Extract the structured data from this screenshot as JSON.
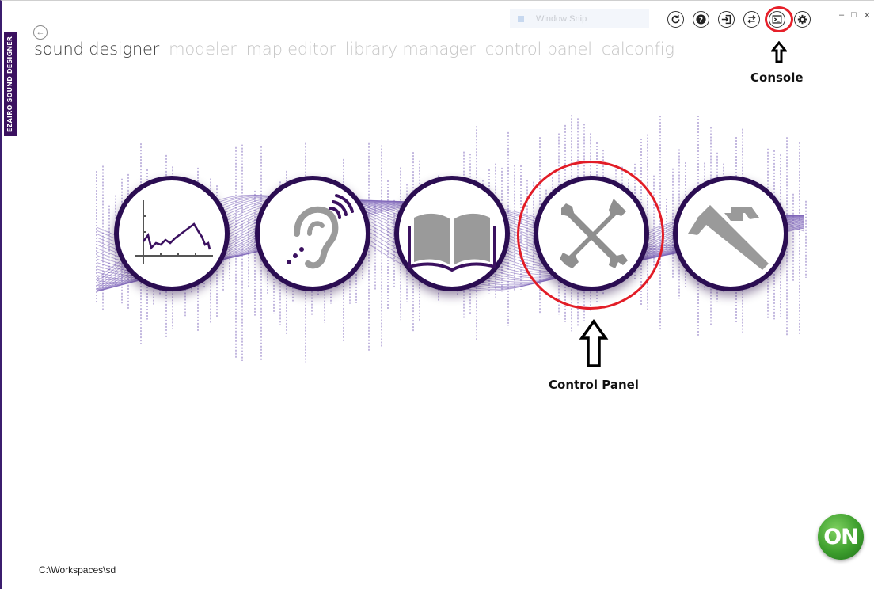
{
  "app": {
    "brand_vertical": "EZAIRO SOUND DESIGNER",
    "workspace_path": "C:\\Workspaces\\sd"
  },
  "nav": {
    "items": [
      "sound designer",
      "modeler",
      "map editor",
      "library manager",
      "control panel",
      "calconfig"
    ],
    "active": "sound designer"
  },
  "toolbar": {
    "icons": [
      "refresh-icon",
      "help-icon",
      "import-icon",
      "sync-icon",
      "console-icon",
      "settings-icon"
    ]
  },
  "overlay": {
    "window_snip": "Window Snip"
  },
  "annotations": {
    "console_label": "Console",
    "control_panel_label": "Control Panel",
    "highlight_color": "#e21d27"
  },
  "tools": [
    {
      "name": "modeler",
      "icon": "frequency-response-graph-icon"
    },
    {
      "name": "hearing",
      "icon": "ear-sound-icon"
    },
    {
      "name": "library manager",
      "icon": "book-icon"
    },
    {
      "name": "control panel",
      "icon": "wrench-screwdriver-icon"
    },
    {
      "name": "calconfig",
      "icon": "caliper-icon"
    }
  ],
  "logo": {
    "text": "ON"
  },
  "colors": {
    "accent": "#2b0d52",
    "wave": "#7b62b8",
    "logo_green": "#3d9e2d"
  }
}
